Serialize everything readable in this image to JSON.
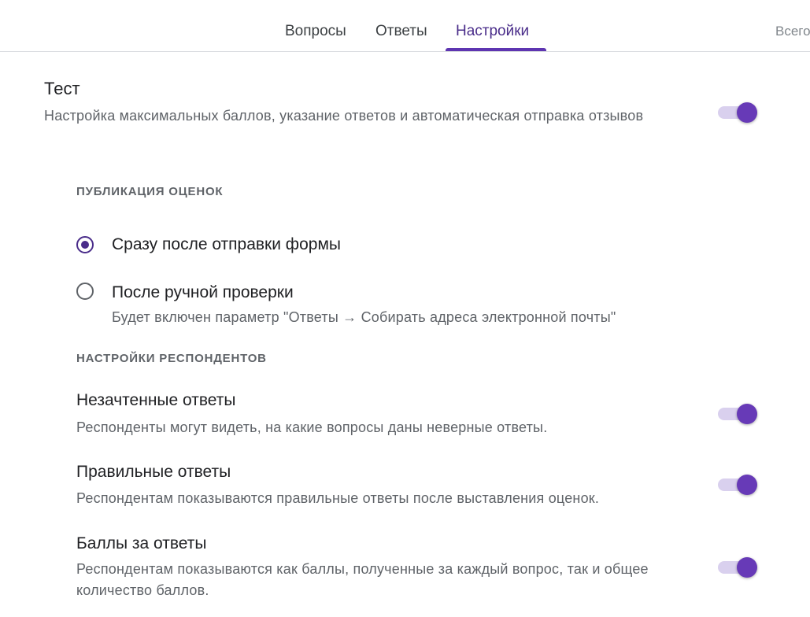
{
  "tabs": {
    "questions": "Вопросы",
    "responses": "Ответы",
    "settings": "Настройки",
    "extra": "Всего"
  },
  "quiz": {
    "title": "Тест",
    "description": "Настройка максимальных баллов, указание ответов и автоматическая отправка отзывов",
    "enabled": true
  },
  "release_grade": {
    "header": "ПУБЛИКАЦИЯ ОЦЕНОК",
    "options": [
      {
        "label": "Сразу после отправки формы",
        "checked": true,
        "hint": ""
      },
      {
        "label": "После ручной проверки",
        "checked": false,
        "hint": "Будет включен параметр \"Ответы → Собирать адреса электронной почты\""
      }
    ]
  },
  "respondent_settings": {
    "header": "НАСТРОЙКИ РЕСПОНДЕНТОВ",
    "items": [
      {
        "title": "Незачтенные ответы",
        "description": "Респонденты могут видеть, на какие вопросы даны неверные ответы.",
        "enabled": true
      },
      {
        "title": "Правильные ответы",
        "description": "Респондентам показываются правильные ответы после выставления оценок.",
        "enabled": true
      },
      {
        "title": "Баллы за ответы",
        "description": "Респондентам показываются как баллы, полученные за каждый вопрос, так и общее количество баллов.",
        "enabled": true
      }
    ]
  },
  "colors": {
    "accent": "#673ab7",
    "accent_dark": "#4a2d8a",
    "track": "#d9d0ee",
    "secondary_text": "#5f6368"
  }
}
